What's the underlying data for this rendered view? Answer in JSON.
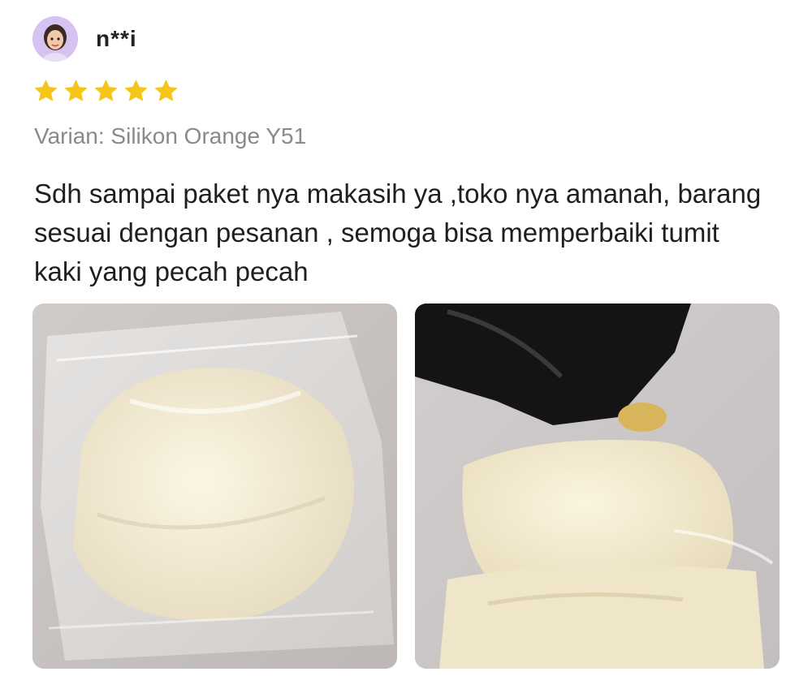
{
  "review": {
    "username": "n**i",
    "avatar_icon": "avatar-memoji-icon",
    "rating": 5,
    "rating_max": 5,
    "star_color": "#f5c518",
    "variant_label": "Varian: Silikon Orange Y51",
    "text": "Sdh sampai paket nya makasih ya ,toko nya amanah, barang sesuai dengan pesanan , semoga bisa memperbaiki tumit kaki yang pecah pecah",
    "photos": [
      {
        "icon": "product-photo-1"
      },
      {
        "icon": "product-photo-2"
      }
    ]
  }
}
